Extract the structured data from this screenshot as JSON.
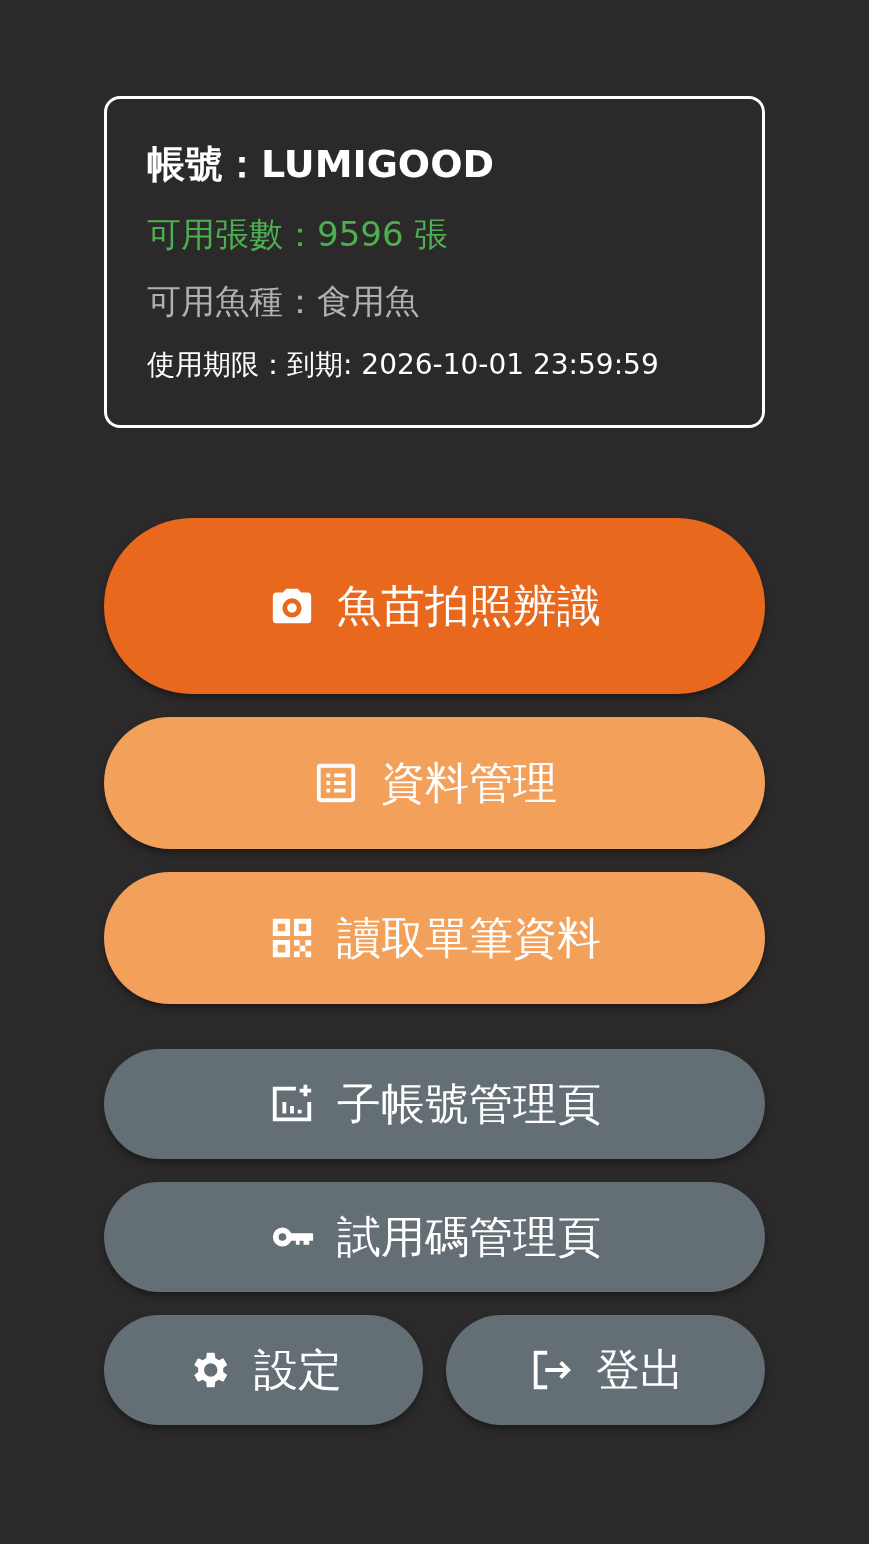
{
  "account_card": {
    "lines": [
      {
        "kind": "account",
        "text": "帳號：LUMIGOOD"
      },
      {
        "kind": "quota",
        "text": "可用張數：9596 張"
      },
      {
        "kind": "species",
        "text": "可用魚種：食用魚"
      },
      {
        "kind": "expiry",
        "text": "使用期限：到期: 2026-10-01 23:59:59"
      }
    ]
  },
  "buttons": [
    {
      "kind": "primary",
      "label": "魚苗拍照辨識"
    },
    {
      "kind": "secondary",
      "label": "資料管理"
    },
    {
      "kind": "secondary",
      "label": "讀取單筆資料"
    },
    {
      "kind": "neutral",
      "label": "子帳號管理頁"
    },
    {
      "kind": "neutral",
      "label": "試用碼管理頁"
    }
  ],
  "bottom_buttons": [
    {
      "kind": "neutral",
      "label": "設定"
    },
    {
      "kind": "neutral",
      "label": "登出"
    }
  ]
}
